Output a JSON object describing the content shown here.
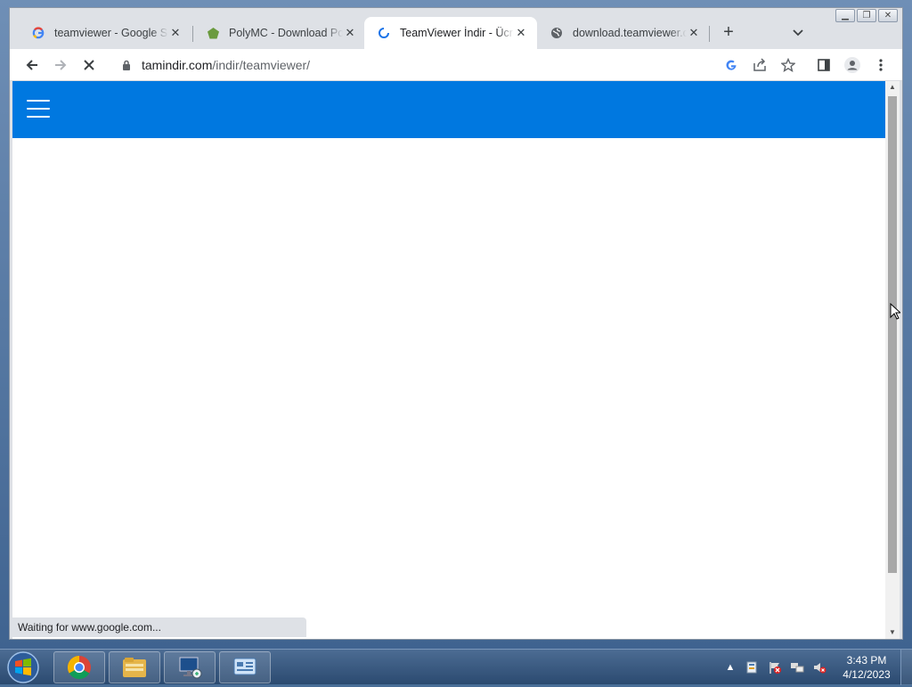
{
  "browser": {
    "tabs": [
      {
        "title": "teamviewer - Google Se",
        "favicon": "google-icon",
        "active": false
      },
      {
        "title": "PolyMC - Download Poly",
        "favicon": "polymc-icon",
        "active": false
      },
      {
        "title": "TeamViewer İndir - Ücre",
        "favicon": "loading-spinner-icon",
        "active": true
      },
      {
        "title": "download.teamviewer.co",
        "favicon": "globe-icon",
        "active": false
      }
    ],
    "new_tab": "+",
    "close_glyph": "✕",
    "url_host": "tamindir.com",
    "url_path": "/indir/teamviewer/",
    "status_text": "Waiting for www.google.com..."
  },
  "site": {
    "header_color": "#0078e0"
  },
  "taskbar": {
    "time": "3:43 PM",
    "date": "4/12/2023"
  },
  "colors": {
    "accent": "#1a73e8",
    "site_header": "#0078e0"
  }
}
